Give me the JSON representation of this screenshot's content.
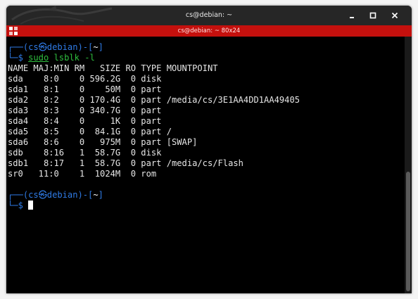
{
  "window": {
    "title": "cs@debian: ~",
    "tab_title": "cs@debian: ~ 80x24"
  },
  "colors": {
    "titlebar": "#262626",
    "tabbar": "#c4100d",
    "prompt_blue": "#2f7be6",
    "command_green": "#2fbf3f",
    "text": "#e6e6e6"
  },
  "icons": {
    "minimize": "minimize-icon",
    "maximize": "maximize-icon",
    "close": "close-icon",
    "tab_menu": "tab-menu-icon",
    "background": "dragon-logo"
  },
  "terminal": {
    "prompt": {
      "corner_top": "┌──(",
      "user": "cs",
      "at_symbol": "㉿",
      "host": "debian",
      "close_paren": ")-[",
      "cwd": "~",
      "close_bracket": "]",
      "corner_bottom": "└─",
      "dollar": "$"
    },
    "command": {
      "program": "sudo",
      "args": "lsblk -l"
    },
    "output_lines": [
      "NAME MAJ:MIN RM   SIZE RO TYPE MOUNTPOINT",
      "sda    8:0    0 596.2G  0 disk",
      "sda1   8:1    0    50M  0 part",
      "sda2   8:2    0 170.4G  0 part /media/cs/3E1AA4DD1AA49405",
      "sda3   8:3    0 340.7G  0 part",
      "sda4   8:4    0     1K  0 part",
      "sda5   8:5    0  84.1G  0 part /",
      "sda6   8:6    0   975M  0 part [SWAP]",
      "sdb    8:16   1  58.7G  0 disk",
      "sdb1   8:17   1  58.7G  0 part /media/cs/Flash",
      "sr0   11:0    1  1024M  0 rom"
    ]
  }
}
